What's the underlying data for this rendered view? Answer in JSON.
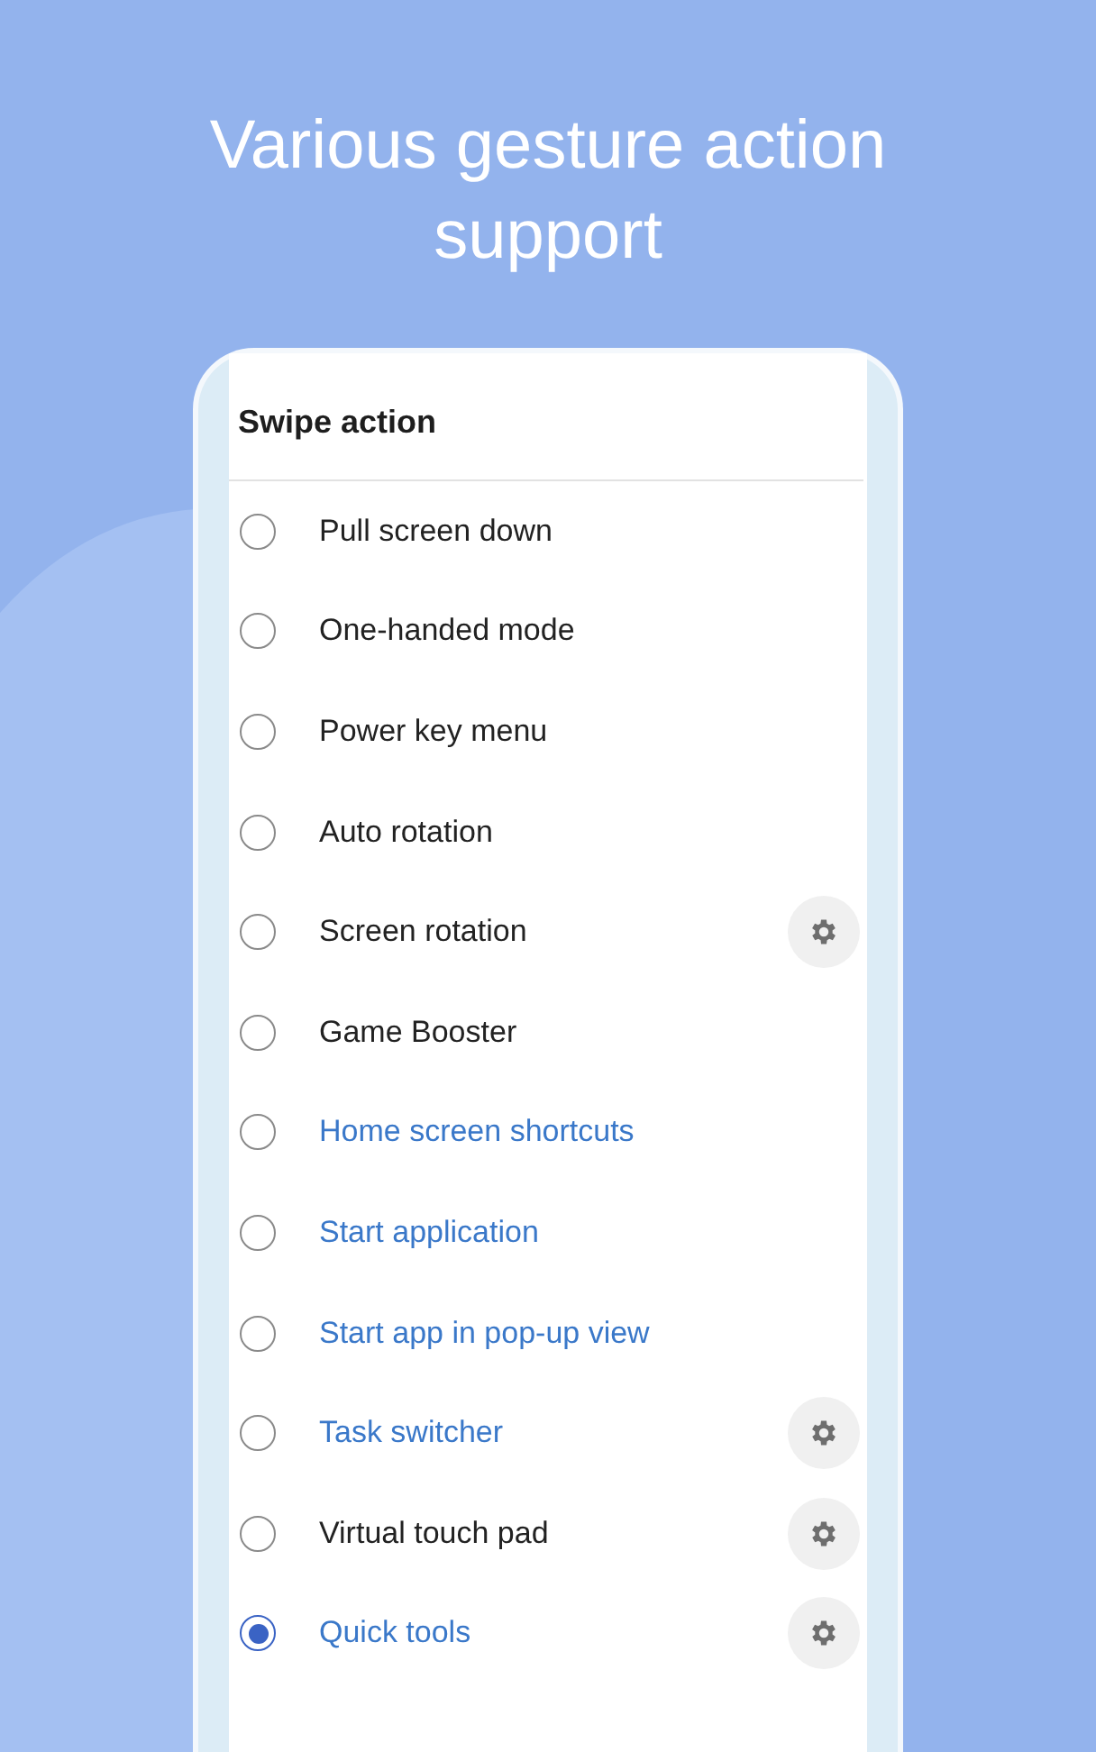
{
  "headline": "Various gesture action support",
  "dialog": {
    "title": "Swipe action",
    "options": [
      {
        "label": "Pull screen down",
        "kind": "system",
        "selected": false,
        "settings": false
      },
      {
        "label": "One-handed mode",
        "kind": "system",
        "selected": false,
        "settings": false
      },
      {
        "label": "Power key menu",
        "kind": "system",
        "selected": false,
        "settings": false
      },
      {
        "label": "Auto rotation",
        "kind": "system",
        "selected": false,
        "settings": false
      },
      {
        "label": "Screen rotation",
        "kind": "system",
        "selected": false,
        "settings": true
      },
      {
        "label": "Game Booster",
        "kind": "system",
        "selected": false,
        "settings": false
      },
      {
        "label": "Home screen shortcuts",
        "kind": "link",
        "selected": false,
        "settings": false
      },
      {
        "label": "Start application",
        "kind": "link",
        "selected": false,
        "settings": false
      },
      {
        "label": "Start app in pop-up view",
        "kind": "link",
        "selected": false,
        "settings": false
      },
      {
        "label": "Task switcher",
        "kind": "link",
        "selected": false,
        "settings": true
      },
      {
        "label": "Virtual touch pad",
        "kind": "system",
        "selected": false,
        "settings": true
      },
      {
        "label": "Quick tools",
        "kind": "link",
        "selected": true,
        "settings": true
      }
    ]
  }
}
